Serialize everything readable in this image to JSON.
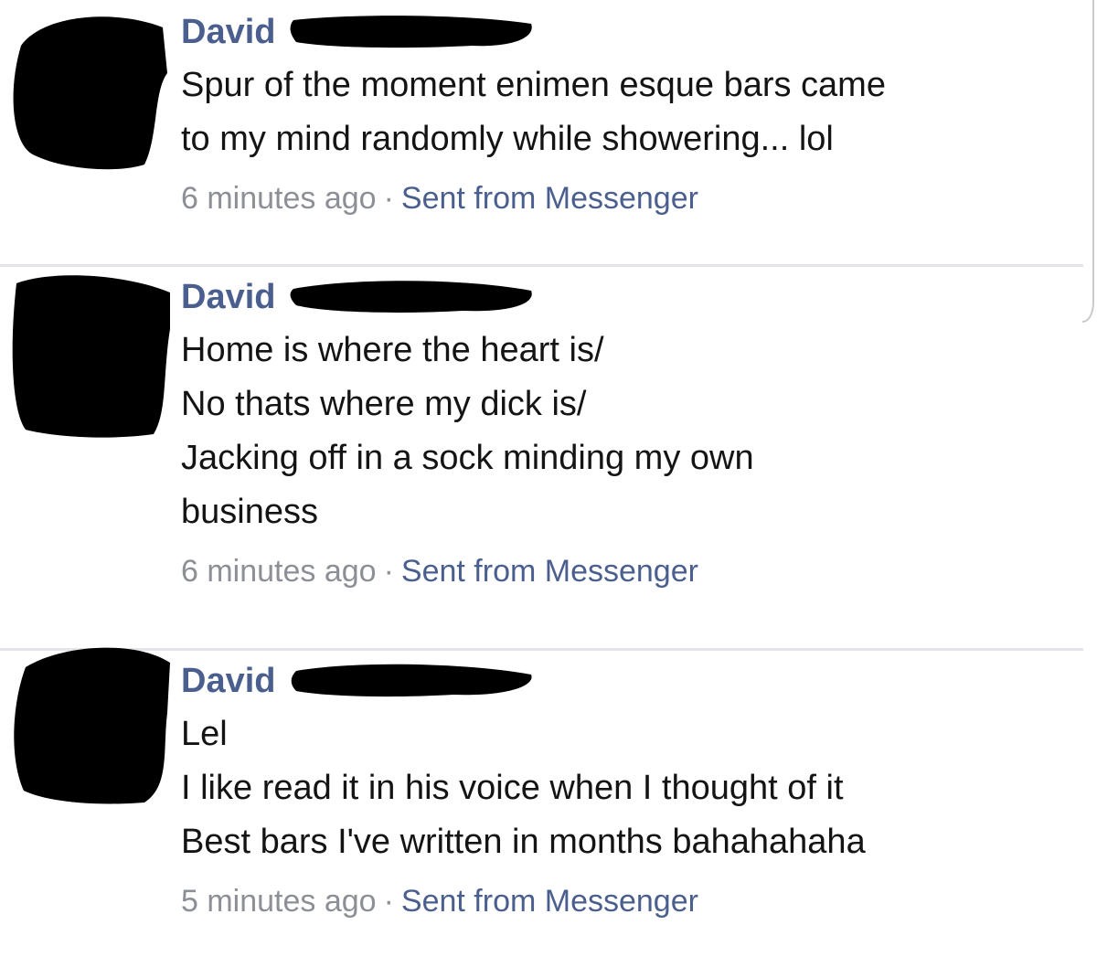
{
  "messages": [
    {
      "author": "David",
      "lines": [
        "Spur of the moment enimen esque bars came",
        "to my mind randomly while showering... lol"
      ],
      "timestamp": "6 minutes ago",
      "separator": "·",
      "source": "Sent from Messenger"
    },
    {
      "author": "David",
      "lines": [
        "Home is where the heart is/",
        "No thats where my dick is/",
        "Jacking off in a sock minding my own",
        "business"
      ],
      "timestamp": "6 minutes ago",
      "separator": "·",
      "source": "Sent from Messenger"
    },
    {
      "author": "David",
      "lines": [
        "Lel",
        "I like read it in his voice when I thought of it",
        "Best bars I've written in months bahahahaha"
      ],
      "timestamp": "5 minutes ago",
      "separator": "·",
      "source": "Sent from Messenger"
    }
  ],
  "colors": {
    "author": "#4b5f8f",
    "body_text": "#141414",
    "timestamp": "#8c8f96",
    "link": "#4b5f8f",
    "divider": "#e4e5e8",
    "redaction": "#000000"
  },
  "icons": {
    "avatar": "redacted-avatar-icon",
    "name_redaction": "redaction-scribble-icon"
  }
}
